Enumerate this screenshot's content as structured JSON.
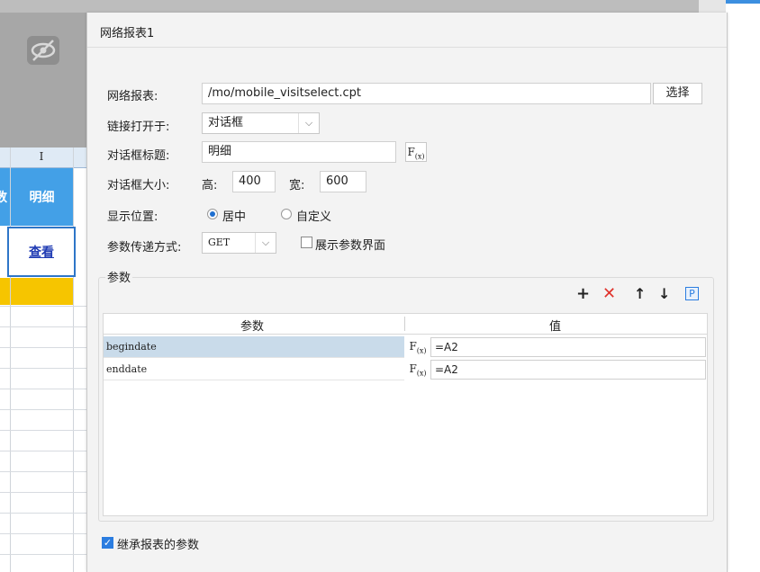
{
  "sheet": {
    "column_header": "I",
    "cell_partial": "数",
    "cell_detail": "明细",
    "cell_link": "查看"
  },
  "dialog": {
    "title": "网络报表1",
    "report_label": "网络报表:",
    "report_path": "/mo/mobile_visitselect.cpt",
    "choose_button": "选择",
    "open_in_label": "链接打开于:",
    "open_in_value": "对话框",
    "dialog_title_label": "对话框标题:",
    "dialog_title_value": "明细",
    "fx_label": "F(x)",
    "dialog_size_label": "对话框大小:",
    "height_label": "高:",
    "height_value": "400",
    "width_label": "宽:",
    "width_value": "600",
    "position_label": "显示位置:",
    "position_center": "居中",
    "position_custom": "自定义",
    "param_method_label": "参数传递方式:",
    "param_method_value": "GET",
    "show_param_ui": "展示参数界面",
    "params_group_label": "参数",
    "toolbar": {
      "add": "+",
      "delete": "✕",
      "up": "↑",
      "down": "↓",
      "p": "P"
    },
    "table_headers": {
      "param": "参数",
      "value": "值"
    },
    "rows": [
      {
        "name": "begindate",
        "value": "=A2"
      },
      {
        "name": "enddate",
        "value": "=A2"
      }
    ],
    "inherit_params": "继承报表的参数"
  },
  "colors": {
    "selected_row": "#c9dbea",
    "cell_blue": "#43a0e7",
    "cell_yellow": "#f6c500",
    "accent": "#2b7de0",
    "delete_red": "#e0322b"
  }
}
